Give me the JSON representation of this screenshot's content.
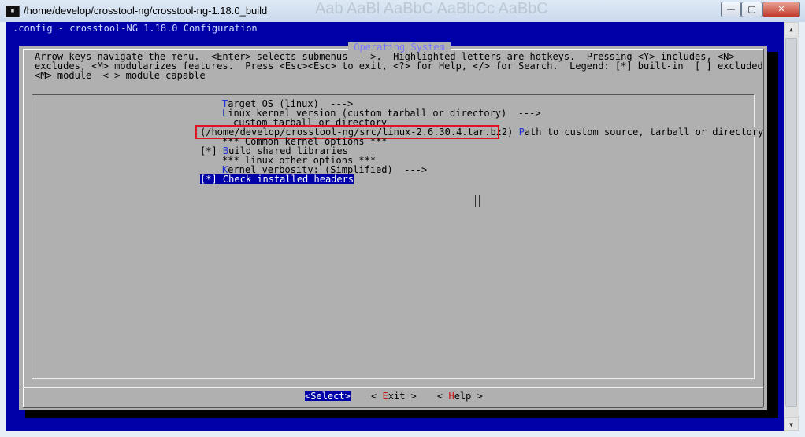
{
  "window": {
    "title": "/home/develop/crosstool-ng/crosstool-ng-1.18.0_build",
    "ghost_text": "Aab  AaBl  AaBbC  AaBbCc  AaBbC",
    "buttons": {
      "minimize": "—",
      "maximize": "▢",
      "close": "✕"
    }
  },
  "terminal": {
    "header": ".config - crosstool-NG 1.18.0 Configuration",
    "dialog_title": " Operating System ",
    "help_lines": [
      "Arrow keys navigate the menu.  <Enter> selects submenus --->.  Highlighted letters are hotkeys.  Pressing <Y> includes, <N>",
      "excludes, <M> modularizes features.  Press <Esc><Esc> to exit, <?> for Help, </> for Search.  Legend: [*] built-in  [ ] excluded",
      "<M> module  < > module capable"
    ],
    "menu": {
      "target_os": {
        "hot": "T",
        "rest": "arget OS (linux)  --->"
      },
      "kernel_version": {
        "hot": "L",
        "rest": "inux kernel version (custom tarball or directory)  --->"
      },
      "custom_label": "custom tarball or directory",
      "path_value": "(/home/develop/crosstool-ng/src/linux-2.6.30.4.tar.bz2)",
      "path_label": {
        "hot": "P",
        "rest": "ath to custom source, tarball or directory"
      },
      "common_options": "*** Common kernel options ***",
      "shared_libs": {
        "mark": "[*] ",
        "hot": "B",
        "rest": "uild shared libraries"
      },
      "linux_other": "*** linux other options ***",
      "verbosity": {
        "hot": "K",
        "rest": "ernel verbosity: (Simplified)  --->"
      },
      "check_headers": {
        "mark": "[*] ",
        "hot": "C",
        "rest": "heck installed headers"
      }
    },
    "buttons": {
      "select": "<Select>",
      "exit": {
        "open": "< ",
        "hot": "E",
        "rest": "xit",
        "close": " >"
      },
      "help": {
        "open": "< ",
        "hot": "H",
        "rest": "elp",
        "close": " >"
      }
    }
  },
  "colors": {
    "term_bg": "#0000a8",
    "dialog_bg": "#b0b0b0",
    "hotkey": "#1e2fd8",
    "highlight_box": "#e0141e"
  }
}
